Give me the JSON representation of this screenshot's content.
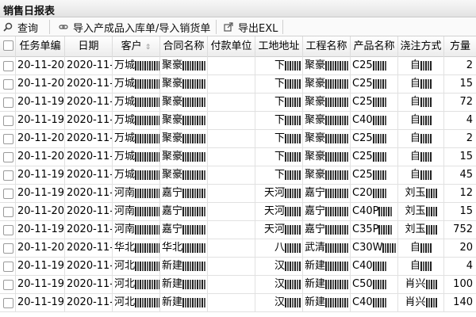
{
  "title": "销售日报表",
  "toolbar": {
    "query": "查询",
    "import": "导入产成品入库单/导入销货单",
    "export": "导出EXL"
  },
  "columns": [
    "",
    "任务单编",
    "日期",
    "客户",
    "合同名称",
    "付款单位",
    "工地地址",
    "工程名称",
    "产品名称",
    "浇注方式",
    "方量"
  ],
  "rows": [
    {
      "task": "20-11-20",
      "date": "2020-11-",
      "cust": "万城",
      "contract": "聚豪",
      "payer": "",
      "addr": "下",
      "proj": "聚豪",
      "prod": "C25",
      "pour": "自",
      "vol": "2"
    },
    {
      "task": "20-11-20",
      "date": "2020-11-",
      "cust": "万城",
      "contract": "聚豪",
      "payer": "",
      "addr": "下",
      "proj": "聚豪",
      "prod": "C25",
      "pour": "自",
      "vol": "15"
    },
    {
      "task": "20-11-19",
      "date": "2020-11-",
      "cust": "万城",
      "contract": "聚豪",
      "payer": "",
      "addr": "下",
      "proj": "聚豪",
      "prod": "C25",
      "pour": "自",
      "vol": "72"
    },
    {
      "task": "20-11-19",
      "date": "2020-11-",
      "cust": "万城",
      "contract": "聚豪",
      "payer": "",
      "addr": "下",
      "proj": "聚豪",
      "prod": "C40",
      "pour": "自",
      "vol": "4"
    },
    {
      "task": "20-11-20",
      "date": "2020-11-",
      "cust": "万城",
      "contract": "聚豪",
      "payer": "",
      "addr": "下",
      "proj": "聚豪",
      "prod": "C25",
      "pour": "自",
      "vol": "2"
    },
    {
      "task": "20-11-20",
      "date": "2020-11-",
      "cust": "万城",
      "contract": "聚豪",
      "payer": "",
      "addr": "下",
      "proj": "聚豪",
      "prod": "C25",
      "pour": "自",
      "vol": "15"
    },
    {
      "task": "20-11-19",
      "date": "2020-11-",
      "cust": "万城",
      "contract": "聚豪",
      "payer": "",
      "addr": "下",
      "proj": "聚豪",
      "prod": "C25",
      "pour": "自",
      "vol": "45"
    },
    {
      "task": "20-11-19",
      "date": "2020-11-",
      "cust": "河南",
      "contract": "嘉宁",
      "payer": "",
      "addr": "天河",
      "proj": "嘉宁",
      "prod": "C20",
      "pour": "刘玉",
      "vol": "12"
    },
    {
      "task": "20-11-20",
      "date": "2020-11-",
      "cust": "河南",
      "contract": "嘉宁",
      "payer": "",
      "addr": "天河",
      "proj": "嘉宁",
      "prod": "C40P",
      "pour": "刘玉",
      "vol": "15"
    },
    {
      "task": "20-11-19",
      "date": "2020-11-",
      "cust": "河南",
      "contract": "嘉宁",
      "payer": "",
      "addr": "天河",
      "proj": "嘉宁",
      "prod": "C35P",
      "pour": "刘玉",
      "vol": "752"
    },
    {
      "task": "20-11-20",
      "date": "2020-11-",
      "cust": "华北",
      "contract": "华北",
      "payer": "",
      "addr": "八",
      "proj": "武清",
      "prod": "C30W",
      "pour": "自",
      "vol": "20"
    },
    {
      "task": "20-11-19",
      "date": "2020-11-",
      "cust": "河北",
      "contract": "新建",
      "payer": "",
      "addr": "汉",
      "proj": "新建",
      "prod": "C40",
      "pour": "自",
      "vol": "4"
    },
    {
      "task": "20-11-19",
      "date": "2020-11-",
      "cust": "河北",
      "contract": "新建",
      "payer": "",
      "addr": "汉",
      "proj": "新建",
      "prod": "C50",
      "pour": "肖兴",
      "vol": "100"
    },
    {
      "task": "20-11-19",
      "date": "2020-11-",
      "cust": "河北",
      "contract": "新建",
      "payer": "",
      "addr": "汉",
      "proj": "新建",
      "prod": "C40",
      "pour": "肖兴",
      "vol": "140"
    }
  ]
}
